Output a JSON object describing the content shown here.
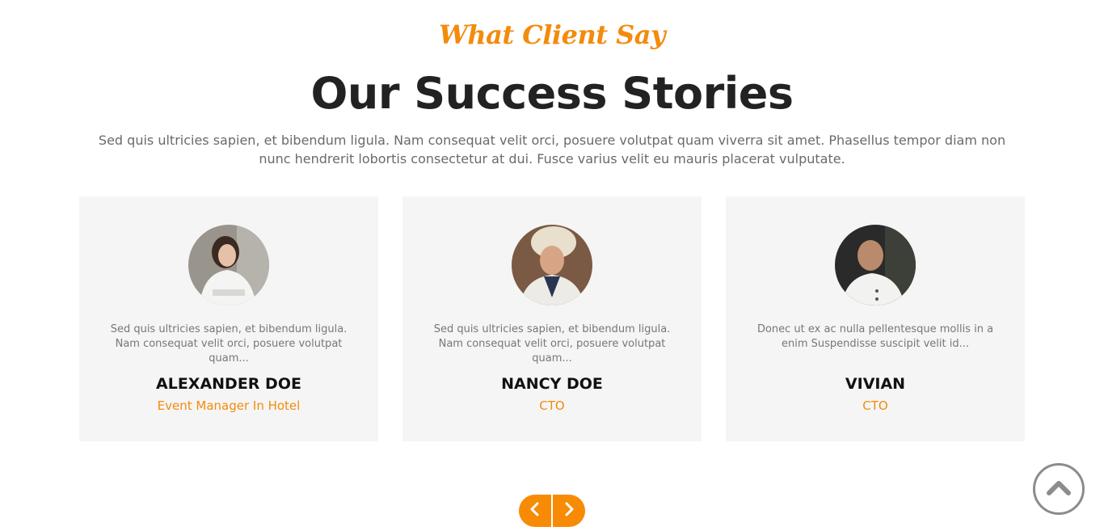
{
  "section": {
    "eyebrow": "What Client Say",
    "title": "Our Success Stories",
    "intro": "Sed quis ultricies sapien, et bibendum ligula. Nam consequat velit orci, posuere volutpat quam viverra sit amet. Phasellus tempor diam non nunc hendrerit lobortis consectetur at dui. Fusce varius velit eu mauris placerat vulputate."
  },
  "testimonials": [
    {
      "quote": "Sed quis ultricies sapien, et bibendum ligula. Nam consequat velit orci, posuere volutpat quam...",
      "name": "ALEXANDER DOE",
      "role": "Event Manager In Hotel"
    },
    {
      "quote": "Sed quis ultricies sapien, et bibendum ligula. Nam consequat velit orci, posuere volutpat quam...",
      "name": "NANCY DOE",
      "role": "CTO"
    },
    {
      "quote": "Donec ut ex ac nulla pellentesque mollis in a enim Suspendisse suscipit velit id...",
      "name": "VIVIAN",
      "role": "CTO"
    }
  ],
  "carousel": {
    "prev_icon": "chevron-left-icon",
    "next_icon": "chevron-right-icon"
  },
  "scroll_top": {
    "icon": "chevron-up-icon"
  },
  "colors": {
    "accent": "#f38b0c",
    "card_bg": "#f5f5f5",
    "heading": "#222222",
    "body_text": "#6a6a6a"
  }
}
